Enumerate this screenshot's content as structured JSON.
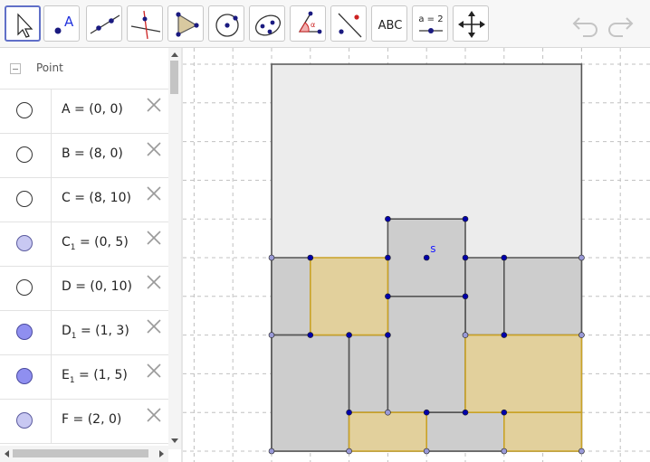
{
  "toolbar": {
    "tools": [
      {
        "name": "move-tool",
        "icon": "cursor-arrow-icon",
        "selected": true
      },
      {
        "name": "point-tool",
        "icon": "point-icon",
        "label": "A"
      },
      {
        "name": "line-tool",
        "icon": "line-through-points-icon"
      },
      {
        "name": "perpendicular-tool",
        "icon": "perpendicular-line-icon"
      },
      {
        "name": "polygon-tool",
        "icon": "polygon-icon"
      },
      {
        "name": "circle-tool",
        "icon": "circle-center-point-icon"
      },
      {
        "name": "conic-tool",
        "icon": "ellipse-icon"
      },
      {
        "name": "angle-tool",
        "icon": "angle-icon",
        "label": "α"
      },
      {
        "name": "reflect-tool",
        "icon": "reflect-about-line-icon"
      },
      {
        "name": "text-tool",
        "icon": "text-icon",
        "label": "ABC"
      },
      {
        "name": "slider-tool",
        "icon": "slider-icon",
        "label": "a = 2"
      },
      {
        "name": "move-graphics-tool",
        "icon": "move-graphics-icon"
      }
    ],
    "undo_icon": "undo-icon",
    "redo_icon": "redo-icon"
  },
  "algebra": {
    "header_label": "Point",
    "items": [
      {
        "marble": "empty",
        "name": "A",
        "sub": "",
        "value": " = (0, 0)"
      },
      {
        "marble": "empty",
        "name": "B",
        "sub": "",
        "value": " = (8, 0)"
      },
      {
        "marble": "empty",
        "name": "C",
        "sub": "",
        "value": " = (8, 10)"
      },
      {
        "marble": "light",
        "name": "C",
        "sub": "1",
        "value": " = (0, 5)"
      },
      {
        "marble": "empty",
        "name": "D",
        "sub": "",
        "value": " = (0, 10)"
      },
      {
        "marble": "dark",
        "name": "D",
        "sub": "1",
        "value": " = (1, 3)"
      },
      {
        "marble": "dark",
        "name": "E",
        "sub": "1",
        "value": " = (1, 5)"
      },
      {
        "marble": "light",
        "name": "F",
        "sub": "",
        "value": " = (2, 0)"
      }
    ]
  },
  "graphics": {
    "point_label": "s",
    "colors": {
      "background_rect": "#ececec",
      "gray_piece": "#cdcdcd",
      "gold_piece": "#e2d09c",
      "gold_stroke": "#c9a227",
      "point_blue": "#0000aa",
      "point_light": "#9a9ad8",
      "grid": "#c0c0c0"
    }
  }
}
